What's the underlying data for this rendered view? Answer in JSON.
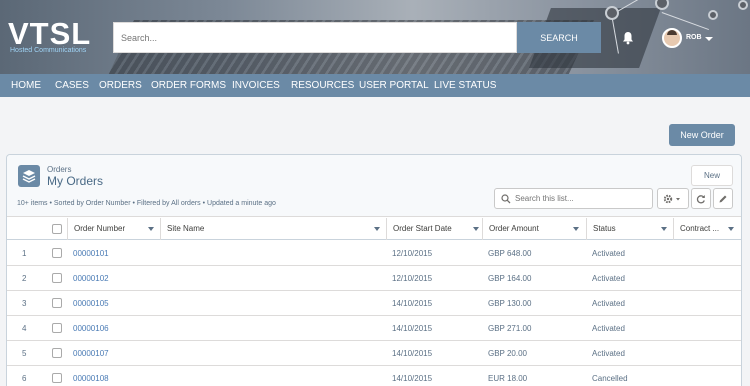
{
  "header": {
    "logo": "VTSL",
    "logo_sub": "Hosted Communications",
    "search_placeholder": "Search...",
    "search_button": "SEARCH",
    "user_name": "ROB"
  },
  "nav": [
    "HOME",
    "CASES",
    "ORDERS",
    "ORDER FORMS",
    "INVOICES",
    "RESOURCES",
    "USER PORTAL",
    "LIVE STATUS"
  ],
  "new_order_button": "New Order",
  "list": {
    "object_type": "Orders",
    "title": "My Orders",
    "meta": "10+ items • Sorted by Order Number • Filtered by All orders • Updated a minute ago",
    "new_button": "New",
    "search_placeholder": "Search this list...",
    "columns": [
      "Order Number",
      "Site Name",
      "Order Start Date",
      "Order Amount",
      "Status",
      "Contract ..."
    ],
    "rows": [
      {
        "num": "1",
        "order": "00000101",
        "site": "",
        "date": "12/10/2015",
        "amount": "GBP 648.00",
        "status": "Activated",
        "contract": ""
      },
      {
        "num": "2",
        "order": "00000102",
        "site": "",
        "date": "12/10/2015",
        "amount": "GBP 164.00",
        "status": "Activated",
        "contract": ""
      },
      {
        "num": "3",
        "order": "00000105",
        "site": "",
        "date": "14/10/2015",
        "amount": "GBP 130.00",
        "status": "Activated",
        "contract": ""
      },
      {
        "num": "4",
        "order": "00000106",
        "site": "",
        "date": "14/10/2015",
        "amount": "GBP 271.00",
        "status": "Activated",
        "contract": ""
      },
      {
        "num": "5",
        "order": "00000107",
        "site": "",
        "date": "14/10/2015",
        "amount": "GBP 20.00",
        "status": "Activated",
        "contract": ""
      },
      {
        "num": "6",
        "order": "00000108",
        "site": "",
        "date": "14/10/2015",
        "amount": "EUR 18.00",
        "status": "Cancelled",
        "contract": ""
      }
    ]
  },
  "colors": {
    "accent": "#6b8aa6",
    "link": "#4a7bb5"
  }
}
